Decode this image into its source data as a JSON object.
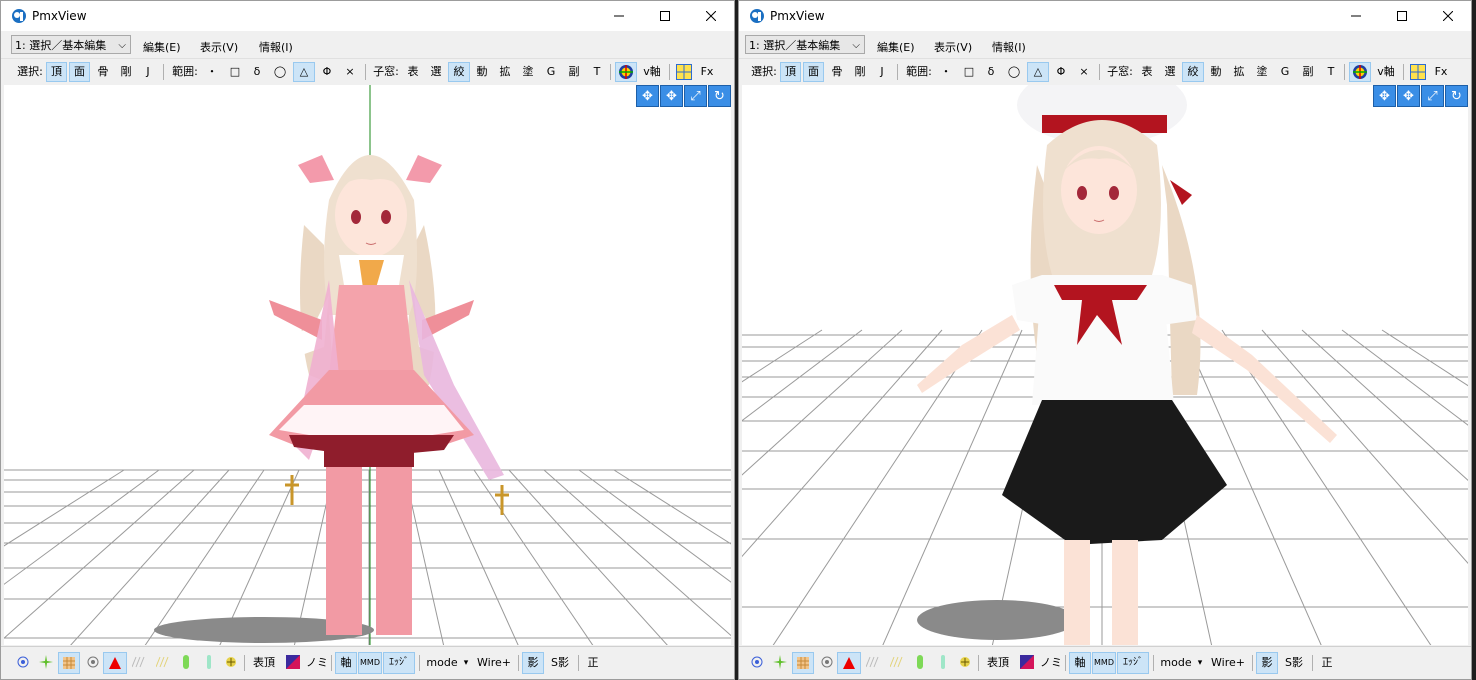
{
  "windows": [
    {
      "title": "PmxView",
      "combo_value": "1: 選択／基本編集",
      "menus": [
        "編集(E)",
        "表示(V)",
        "情報(I)"
      ],
      "toolbar": {
        "select_label": "選択:",
        "select_items": [
          "頂",
          "面",
          "骨",
          "剛",
          "J"
        ],
        "range_label": "範囲:",
        "range_items": [
          "・",
          "□",
          "δ",
          "◯",
          "△",
          "Φ",
          "×"
        ],
        "child_label": "子窓:",
        "child_items": [
          "表",
          "選",
          "絞",
          "動",
          "拡",
          "塗",
          "G",
          "副",
          "T"
        ],
        "v_axis": "v軸",
        "fx": "Fx"
      },
      "status": {
        "table_vertex": "表頂",
        "nomi": "ノミ",
        "axis": "軸",
        "mmd": "MMD",
        "edge": "ｴｯｼﾞ",
        "mode": "mode",
        "mode_arrow": "▾",
        "wire": "Wire+",
        "shadow": "影",
        "sshadow": "S影",
        "sei": "正"
      },
      "model": "magical-girl-pink-dress"
    },
    {
      "title": "PmxView",
      "combo_value": "1: 選択／基本編集",
      "menus": [
        "編集(E)",
        "表示(V)",
        "情報(I)"
      ],
      "toolbar": {
        "select_label": "選択:",
        "select_items": [
          "頂",
          "面",
          "骨",
          "剛",
          "J"
        ],
        "range_label": "範囲:",
        "range_items": [
          "・",
          "□",
          "δ",
          "◯",
          "△",
          "Φ",
          "×"
        ],
        "child_label": "子窓:",
        "child_items": [
          "表",
          "選",
          "絞",
          "動",
          "拡",
          "塗",
          "G",
          "副",
          "T"
        ],
        "v_axis": "v軸",
        "fx": "Fx"
      },
      "status": {
        "table_vertex": "表頂",
        "nomi": "ノミ",
        "axis": "軸",
        "mmd": "MMD",
        "edge": "ｴｯｼﾞ",
        "mode": "mode",
        "mode_arrow": "▾",
        "wire": "Wire+",
        "shadow": "影",
        "sshadow": "S影",
        "sei": "正"
      },
      "model": "sailor-uniform-with-beret"
    }
  ],
  "colors": {
    "accent": "#3a8ee6",
    "toggle_on": "#cce4f7",
    "pink_dress": "#f4a3ab",
    "hair": "#efe0cf",
    "skirt": "#1a1a1a",
    "ribbon": "#b3141f"
  }
}
